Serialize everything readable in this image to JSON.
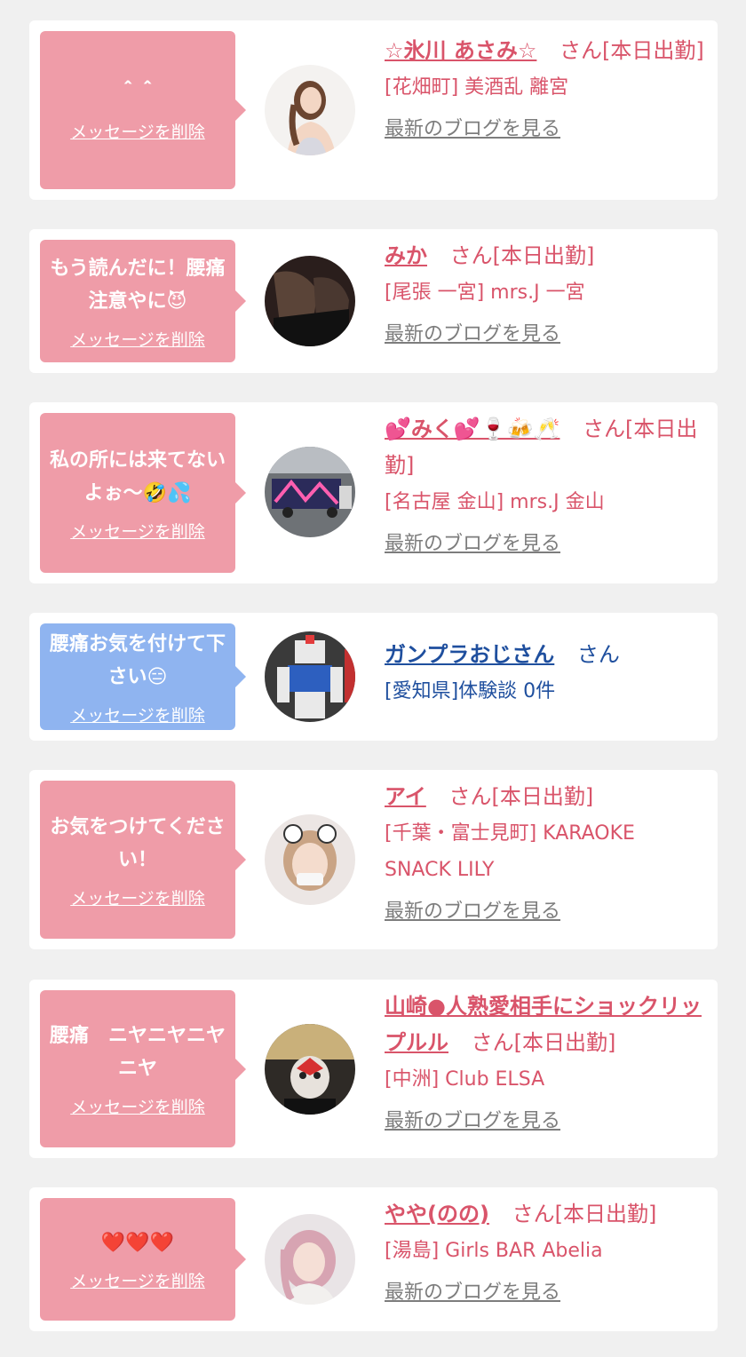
{
  "delete_label": "メッセージを削除",
  "blog_label": "最新のブログを見る",
  "colors": {
    "pink_bubble": "#ef9ca8",
    "blue_bubble": "#8fb4f0",
    "pink_text": "#d9546a",
    "blue_text": "#1f4f9e",
    "link_gray": "#7d7d7d",
    "page_bg": "#f0f0f0"
  },
  "items": [
    {
      "message": "＾＾",
      "name": "☆氷川 あさみ☆",
      "suffix": "さん[本日出勤]",
      "shop": "[花畑町] 美酒乱 離宮",
      "blog": "最新のブログを見る",
      "avatar": "woman-portrait"
    },
    {
      "message": "もう読んだに！腰痛注意やに😈",
      "name": "みか",
      "suffix": "さん[本日出勤]",
      "shop": "[尾張 一宮] mrs.J 一宮",
      "blog": "最新のブログを見る",
      "avatar": "legs-photo"
    },
    {
      "message": "私の所には来てないよぉ〜🤣💦",
      "name": "💕みく💕🍷🍻🥂",
      "suffix": "さん[本日出勤]",
      "shop": "[名古屋 金山] mrs.J 金山",
      "blog": "最新のブログを見る",
      "avatar": "truck-photo"
    },
    {
      "message": "腰痛お気を付けて下さい😑",
      "name": "ガンプラおじさん",
      "suffix": "さん",
      "shop": "[愛知県]体験談 0件",
      "blog": "",
      "avatar": "gundam-model"
    },
    {
      "message": "お気をつけてください！",
      "name": "アイ",
      "suffix": "さん[本日出勤]",
      "shop": "[千葉・富士見町] KARAOKE SNACK LILY",
      "blog": "最新のブログを見る",
      "avatar": "girl-mask-photo"
    },
    {
      "message": "腰痛　ニヤニヤニヤニヤ",
      "name": "山崎●人熟愛相手にショックリップルル",
      "suffix": "さん[本日出勤]",
      "shop": "[中洲] Club ELSA",
      "blog": "最新のブログを見る",
      "avatar": "hero-mask-photo"
    },
    {
      "message": "❤️❤️❤️",
      "name": "やや(のの)",
      "suffix": "さん[本日出勤]",
      "shop": "[湯島] Girls BAR Abelia",
      "blog": "最新のブログを見る",
      "avatar": "pink-hair-photo"
    }
  ]
}
